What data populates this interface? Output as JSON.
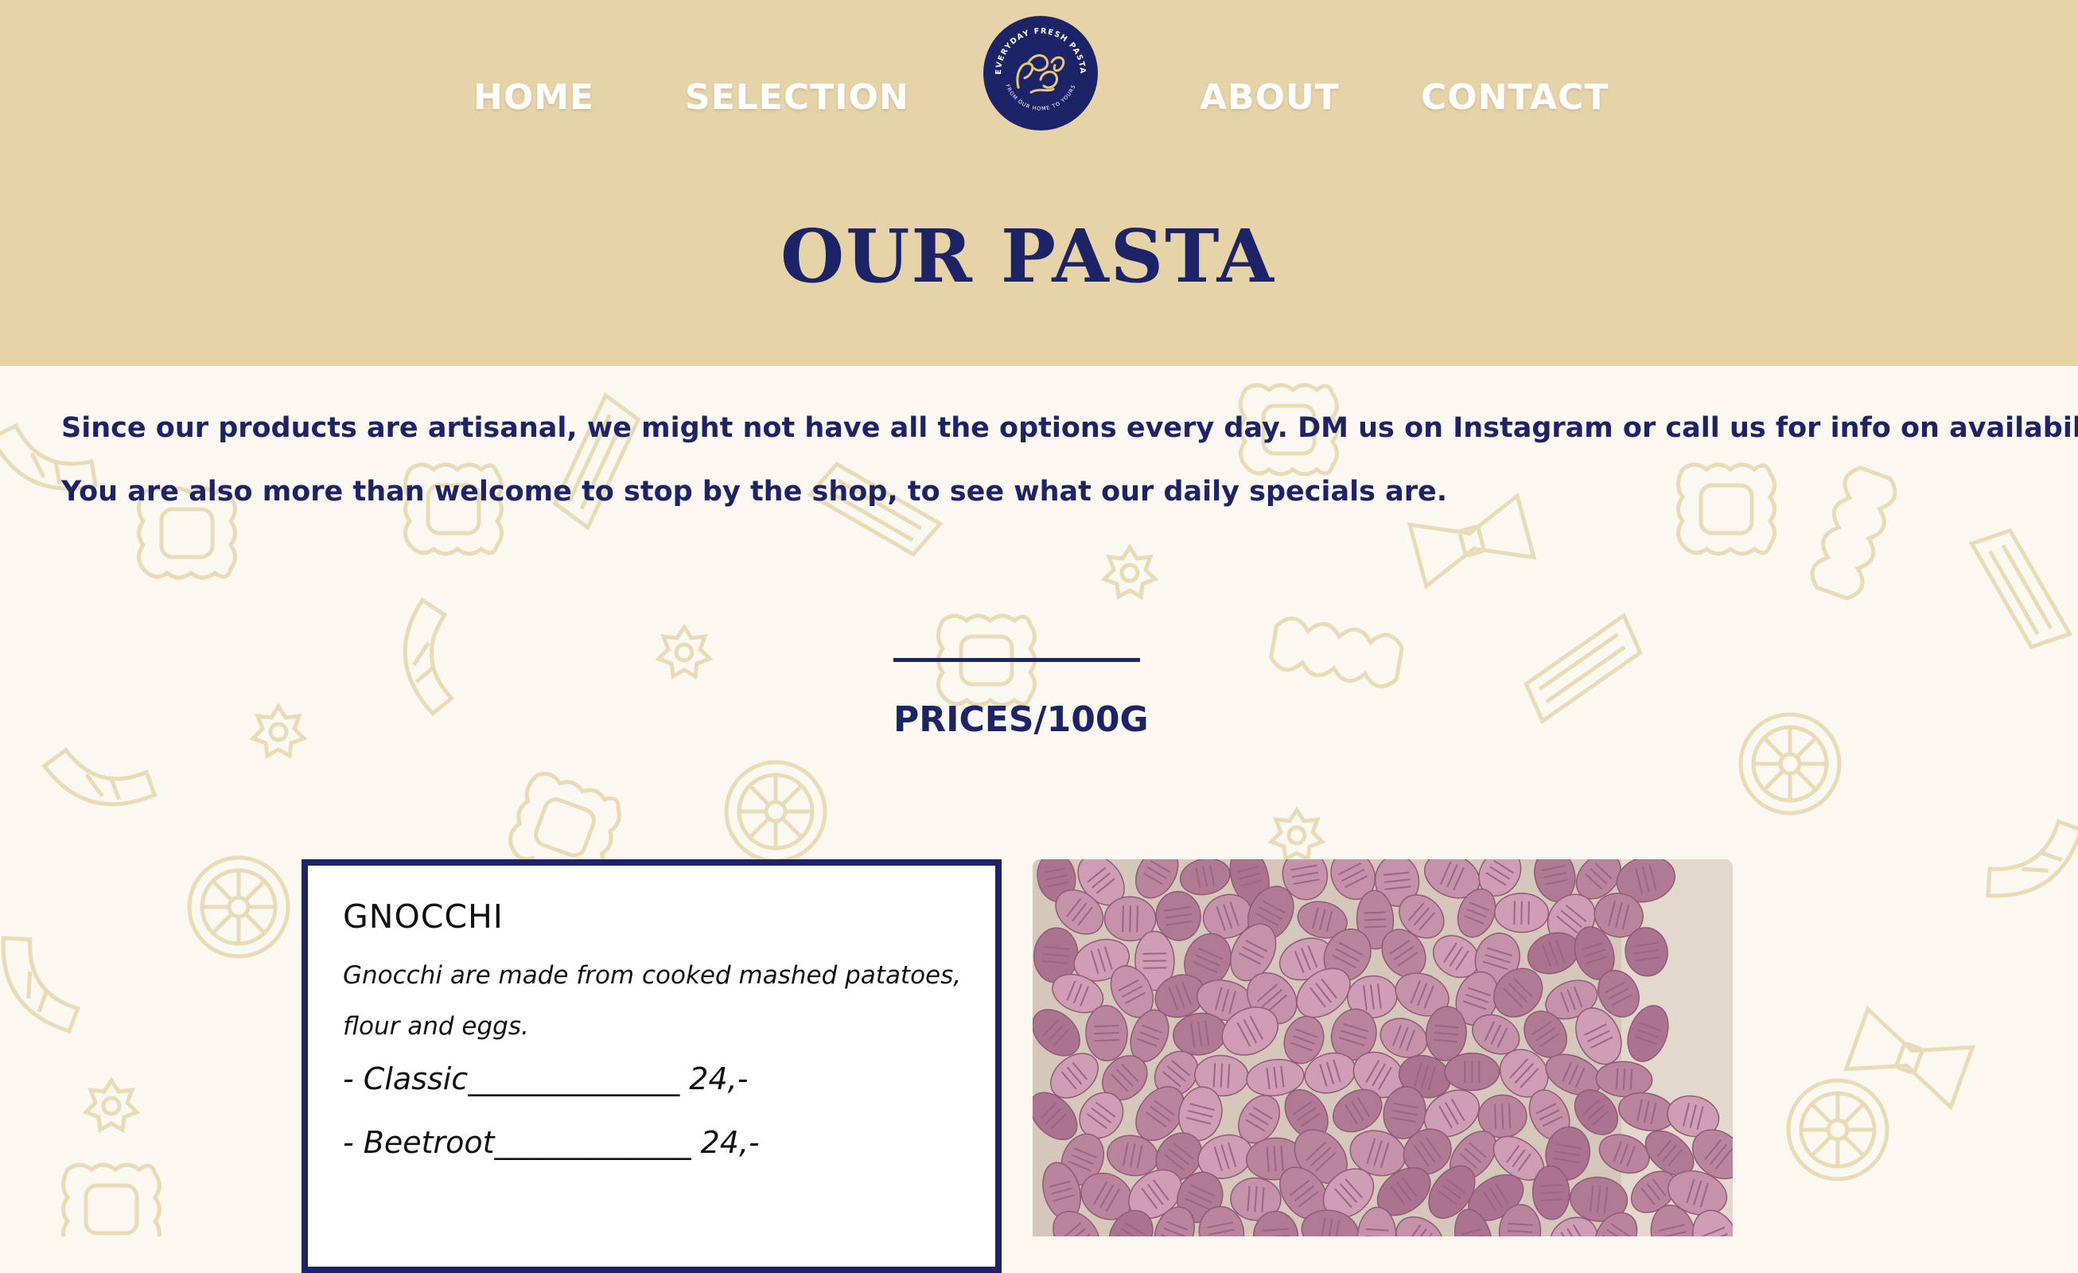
{
  "nav": {
    "home": "HOME",
    "selection": "SELECTION",
    "about": "ABOUT",
    "contact": "CONTACT"
  },
  "logo": {
    "top_text": "EVERYDAY FRESH PASTA",
    "bottom_text": "FROM OUR HOME TO YOURS"
  },
  "page_title": "OUR PASTA",
  "intro": {
    "line1": "Since our products are artisanal, we might not have all the options every day. DM us on Instagram or call us for info on availability.",
    "line2": "You are also more than welcome to stop by the shop, to see what our daily specials are."
  },
  "prices_heading": "PRICES/100G",
  "product": {
    "name": "GNOCCHI",
    "desc_line1": "Gnocchi are made from cooked mashed patatoes,",
    "desc_line2": "flour and eggs.",
    "price1": "- Classic______________ 24,-",
    "price2": "- Beetroot_____________ 24,-"
  },
  "colors": {
    "header_bg": "#e6d3a8",
    "navy": "#1c2366",
    "pattern": "#eadbb7",
    "gnocchi": "#b9849c"
  },
  "icons": {
    "logo": "fresco-logo-icon",
    "photo": "gnocchi-photo"
  }
}
